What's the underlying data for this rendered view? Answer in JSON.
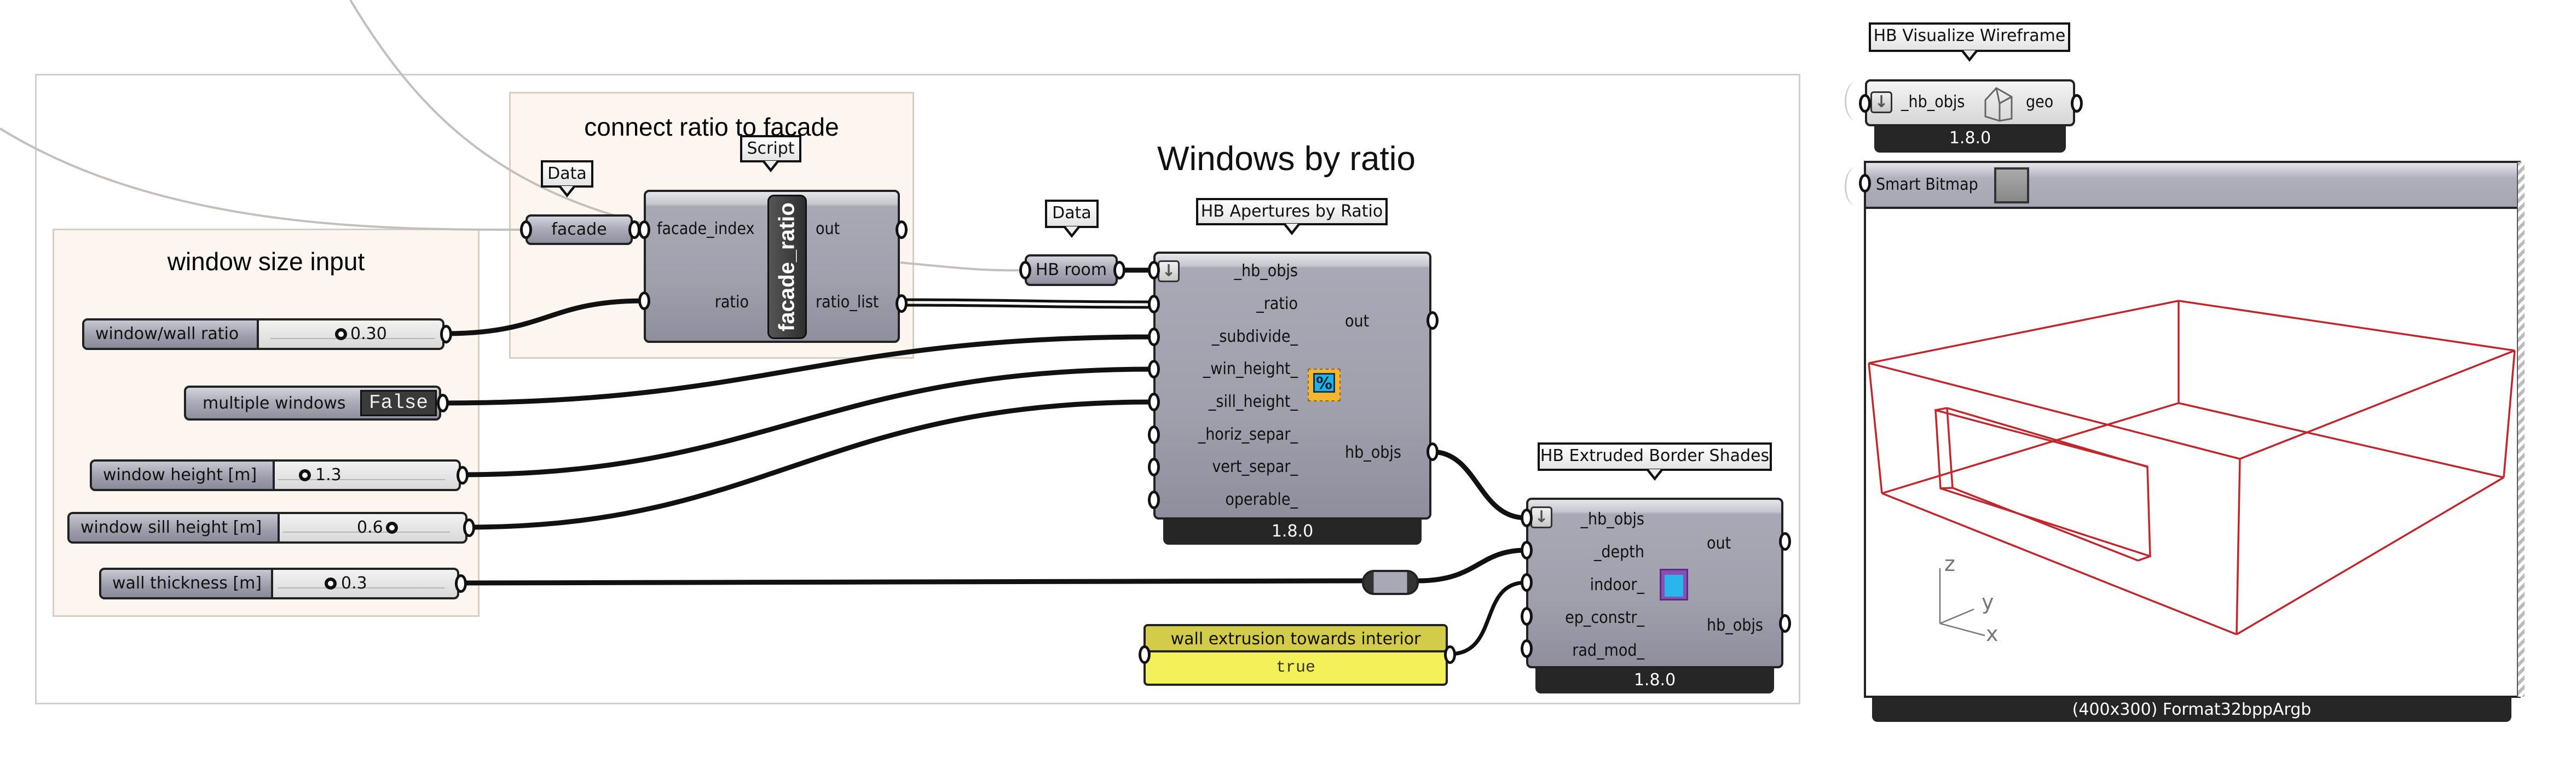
{
  "canvas": {
    "groups": {
      "window_size_input": {
        "title": "window size input"
      },
      "connect_ratio": {
        "title": "connect ratio to facade"
      },
      "windows_by_ratio": {
        "title": "Windows by ratio"
      }
    },
    "colors": {
      "group_fill": "#fdf6f0",
      "component_body": "#a4a4b2",
      "wire": "#111111",
      "wire_faint": "#b8b8b8",
      "panel_yellow": "#f5f15a",
      "wireframe_red": "#c0272d"
    }
  },
  "sliders": [
    {
      "name": "window/wall ratio",
      "value": "0.30",
      "fraction": 0.3
    },
    {
      "name": "window height [m]",
      "value": "1.3",
      "fraction": 0.13
    },
    {
      "name": "window sill height [m]",
      "value": "0.6",
      "fraction": 0.55
    },
    {
      "name": "wall thickness [m]",
      "value": "0.3",
      "fraction": 0.3
    }
  ],
  "toggle": {
    "name": "multiple windows",
    "value": "False"
  },
  "facade_param": {
    "tooltip": "Data",
    "label": "facade"
  },
  "script": {
    "tooltip": "Script",
    "name": "facade_ratio",
    "inputs": [
      "facade_index",
      "ratio"
    ],
    "outputs": [
      "out",
      "ratio_list"
    ]
  },
  "hb_room_param": {
    "tooltip": "Data",
    "label": "HB room"
  },
  "apertures": {
    "tooltip": "HB Apertures by Ratio",
    "inputs": [
      "_hb_objs",
      "_ratio",
      "_subdivide_",
      "_win_height_",
      "_sill_height_",
      "_horiz_separ_",
      "vert_separ_",
      "operable_"
    ],
    "outputs": [
      "out",
      "hb_objs"
    ],
    "icon": "percent-icon",
    "version": "1.8.0"
  },
  "shades": {
    "tooltip": "HB Extruded Border Shades",
    "inputs": [
      "_hb_objs",
      "_depth",
      "indoor_",
      "ep_constr_",
      "rad_mod_"
    ],
    "outputs": [
      "out",
      "hb_objs"
    ],
    "icon": "extruded-box-icon",
    "version": "1.8.0"
  },
  "panel": {
    "title": "wall extrusion towards interior",
    "value": "true"
  },
  "wireframe": {
    "tooltip": "HB Visualize Wireframe",
    "input": "_hb_objs",
    "output": "geo",
    "icon": "house-wireframe-icon",
    "version": "1.8.0"
  },
  "bitmap": {
    "title": "Smart Bitmap",
    "icon": "image-icon",
    "footer": "(400x300) Format32bppArgb",
    "axes": {
      "z": "z",
      "y": "y",
      "x": "x"
    }
  }
}
